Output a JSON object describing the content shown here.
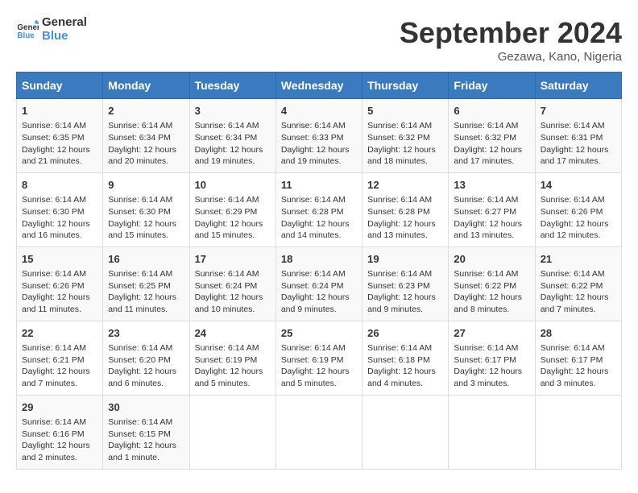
{
  "logo": {
    "line1": "General",
    "line2": "Blue"
  },
  "title": "September 2024",
  "location": "Gezawa, Kano, Nigeria",
  "days_of_week": [
    "Sunday",
    "Monday",
    "Tuesday",
    "Wednesday",
    "Thursday",
    "Friday",
    "Saturday"
  ],
  "weeks": [
    [
      {
        "day": "1",
        "sunrise": "6:14 AM",
        "sunset": "6:35 PM",
        "daylight": "12 hours and 21 minutes."
      },
      {
        "day": "2",
        "sunrise": "6:14 AM",
        "sunset": "6:34 PM",
        "daylight": "12 hours and 20 minutes."
      },
      {
        "day": "3",
        "sunrise": "6:14 AM",
        "sunset": "6:34 PM",
        "daylight": "12 hours and 19 minutes."
      },
      {
        "day": "4",
        "sunrise": "6:14 AM",
        "sunset": "6:33 PM",
        "daylight": "12 hours and 19 minutes."
      },
      {
        "day": "5",
        "sunrise": "6:14 AM",
        "sunset": "6:32 PM",
        "daylight": "12 hours and 18 minutes."
      },
      {
        "day": "6",
        "sunrise": "6:14 AM",
        "sunset": "6:32 PM",
        "daylight": "12 hours and 17 minutes."
      },
      {
        "day": "7",
        "sunrise": "6:14 AM",
        "sunset": "6:31 PM",
        "daylight": "12 hours and 17 minutes."
      }
    ],
    [
      {
        "day": "8",
        "sunrise": "6:14 AM",
        "sunset": "6:30 PM",
        "daylight": "12 hours and 16 minutes."
      },
      {
        "day": "9",
        "sunrise": "6:14 AM",
        "sunset": "6:30 PM",
        "daylight": "12 hours and 15 minutes."
      },
      {
        "day": "10",
        "sunrise": "6:14 AM",
        "sunset": "6:29 PM",
        "daylight": "12 hours and 15 minutes."
      },
      {
        "day": "11",
        "sunrise": "6:14 AM",
        "sunset": "6:28 PM",
        "daylight": "12 hours and 14 minutes."
      },
      {
        "day": "12",
        "sunrise": "6:14 AM",
        "sunset": "6:28 PM",
        "daylight": "12 hours and 13 minutes."
      },
      {
        "day": "13",
        "sunrise": "6:14 AM",
        "sunset": "6:27 PM",
        "daylight": "12 hours and 13 minutes."
      },
      {
        "day": "14",
        "sunrise": "6:14 AM",
        "sunset": "6:26 PM",
        "daylight": "12 hours and 12 minutes."
      }
    ],
    [
      {
        "day": "15",
        "sunrise": "6:14 AM",
        "sunset": "6:26 PM",
        "daylight": "12 hours and 11 minutes."
      },
      {
        "day": "16",
        "sunrise": "6:14 AM",
        "sunset": "6:25 PM",
        "daylight": "12 hours and 11 minutes."
      },
      {
        "day": "17",
        "sunrise": "6:14 AM",
        "sunset": "6:24 PM",
        "daylight": "12 hours and 10 minutes."
      },
      {
        "day": "18",
        "sunrise": "6:14 AM",
        "sunset": "6:24 PM",
        "daylight": "12 hours and 9 minutes."
      },
      {
        "day": "19",
        "sunrise": "6:14 AM",
        "sunset": "6:23 PM",
        "daylight": "12 hours and 9 minutes."
      },
      {
        "day": "20",
        "sunrise": "6:14 AM",
        "sunset": "6:22 PM",
        "daylight": "12 hours and 8 minutes."
      },
      {
        "day": "21",
        "sunrise": "6:14 AM",
        "sunset": "6:22 PM",
        "daylight": "12 hours and 7 minutes."
      }
    ],
    [
      {
        "day": "22",
        "sunrise": "6:14 AM",
        "sunset": "6:21 PM",
        "daylight": "12 hours and 7 minutes."
      },
      {
        "day": "23",
        "sunrise": "6:14 AM",
        "sunset": "6:20 PM",
        "daylight": "12 hours and 6 minutes."
      },
      {
        "day": "24",
        "sunrise": "6:14 AM",
        "sunset": "6:19 PM",
        "daylight": "12 hours and 5 minutes."
      },
      {
        "day": "25",
        "sunrise": "6:14 AM",
        "sunset": "6:19 PM",
        "daylight": "12 hours and 5 minutes."
      },
      {
        "day": "26",
        "sunrise": "6:14 AM",
        "sunset": "6:18 PM",
        "daylight": "12 hours and 4 minutes."
      },
      {
        "day": "27",
        "sunrise": "6:14 AM",
        "sunset": "6:17 PM",
        "daylight": "12 hours and 3 minutes."
      },
      {
        "day": "28",
        "sunrise": "6:14 AM",
        "sunset": "6:17 PM",
        "daylight": "12 hours and 3 minutes."
      }
    ],
    [
      {
        "day": "29",
        "sunrise": "6:14 AM",
        "sunset": "6:16 PM",
        "daylight": "12 hours and 2 minutes."
      },
      {
        "day": "30",
        "sunrise": "6:14 AM",
        "sunset": "6:15 PM",
        "daylight": "12 hours and 1 minute."
      },
      null,
      null,
      null,
      null,
      null
    ]
  ]
}
